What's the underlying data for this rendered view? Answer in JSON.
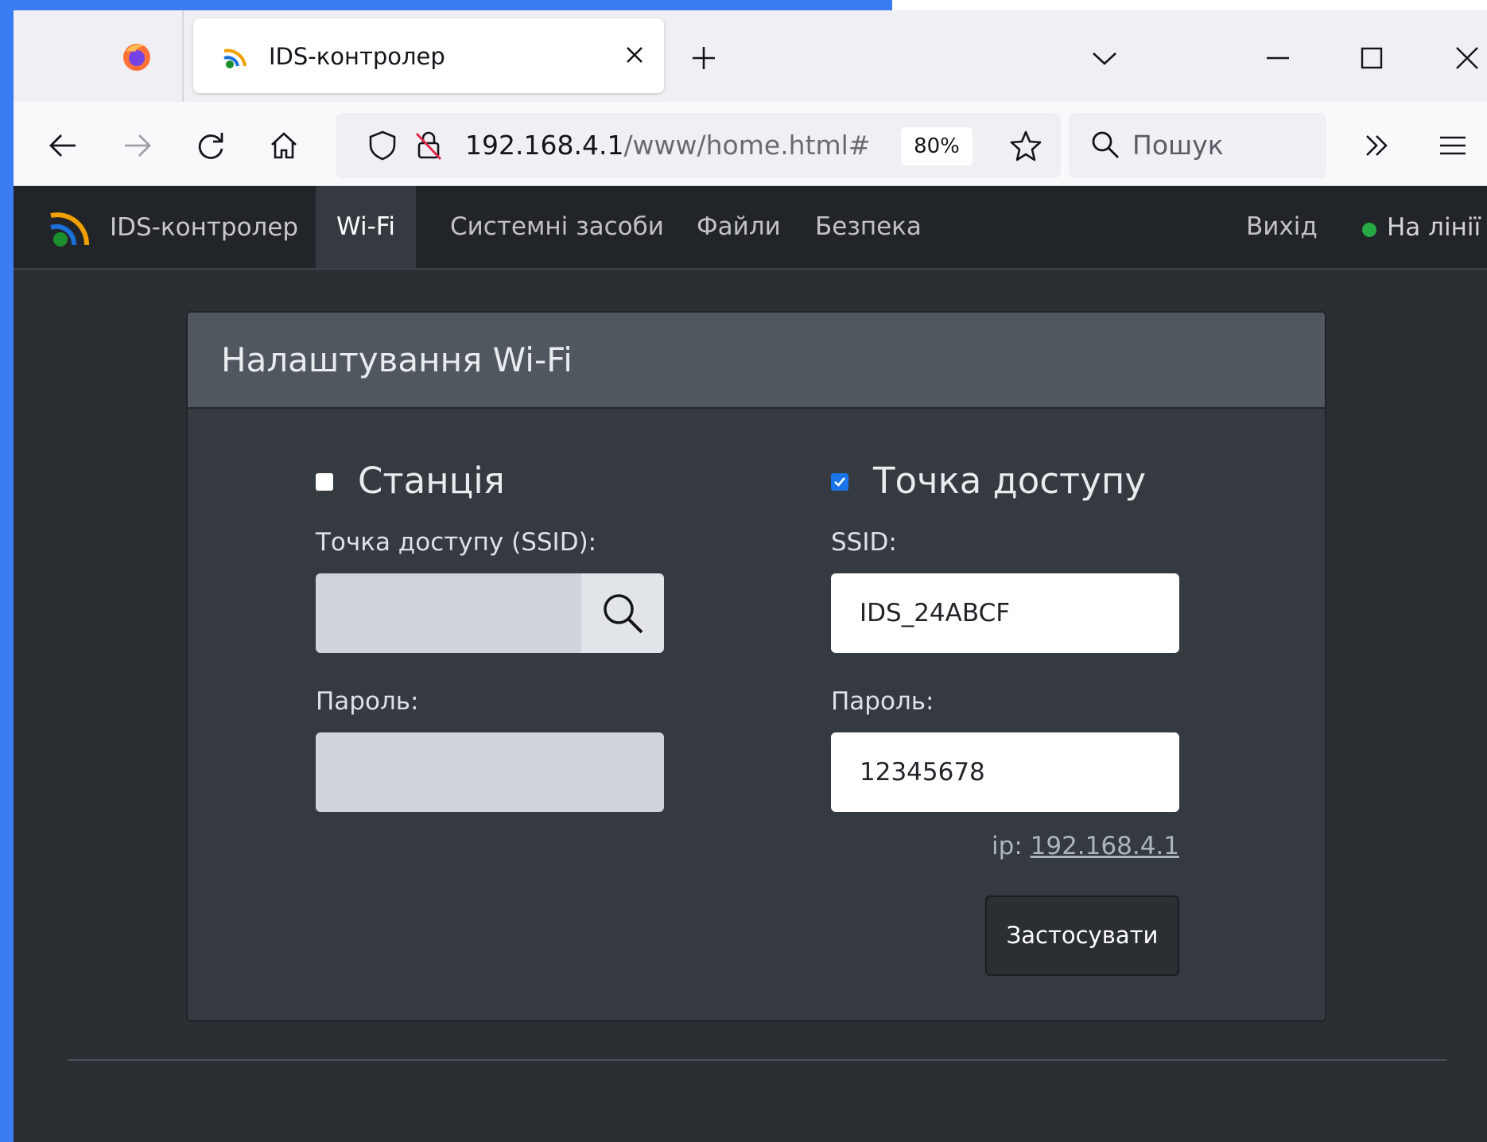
{
  "browser": {
    "tab_title": "IDS-контролер",
    "url_host": "192.168.4.1",
    "url_path": "/www/home.html#",
    "zoom": "80%",
    "search_placeholder": "Пошук"
  },
  "site": {
    "brand": "IDS-контролер",
    "nav": {
      "wifi": "Wi-Fi",
      "system": "Системні засоби",
      "files": "Файли",
      "security": "Безпека",
      "logout": "Вихід"
    },
    "status": "На лінії",
    "status_color": "#28a745"
  },
  "card": {
    "title": "Налаштування Wi-Fi",
    "station": {
      "label": "Станція",
      "checked": false,
      "ssid_label": "Точка доступу (SSID):",
      "ssid_value": "",
      "password_label": "Пароль:",
      "password_value": ""
    },
    "access_point": {
      "label": "Точка доступу",
      "checked": true,
      "ssid_label": "SSID:",
      "ssid_value": "IDS_24ABCF",
      "password_label": "Пароль:",
      "password_value": "12345678",
      "ip_prefix": "ip:",
      "ip_value": "192.168.4.1"
    },
    "apply_label": "Застосувати"
  },
  "icons": [
    "firefox-logo-icon",
    "wifi-logo-icon",
    "close-icon",
    "plus-icon",
    "chevron-down-icon",
    "minimize-icon",
    "maximize-icon",
    "back-arrow-icon",
    "forward-arrow-icon",
    "reload-icon",
    "home-icon",
    "shield-icon",
    "insecure-lock-icon",
    "star-icon",
    "search-icon",
    "overflow-chevrons-icon",
    "hamburger-menu-icon",
    "magnifier-icon",
    "checkmark-icon"
  ]
}
